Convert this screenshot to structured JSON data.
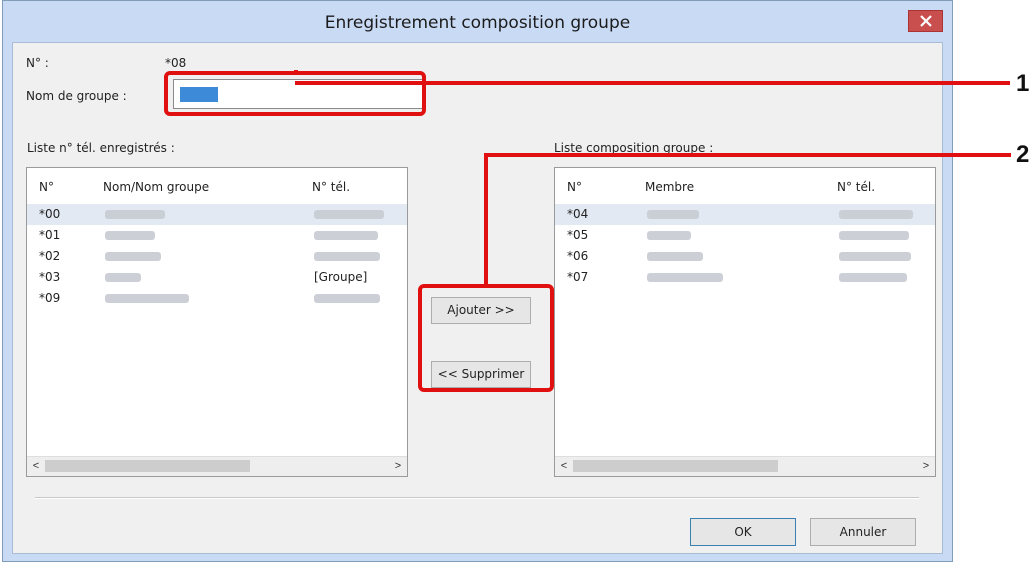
{
  "window": {
    "title": "Enregistrement composition groupe",
    "close_icon": "close-icon"
  },
  "fields": {
    "number_label": "N° :",
    "number_value": "*08",
    "group_name_label": "Nom de groupe :",
    "group_name_value": ""
  },
  "left_list": {
    "title": "Liste n° tél. enregistrés :",
    "columns": [
      "N°",
      "Nom/Nom groupe",
      "N° tél."
    ],
    "rows": [
      {
        "no": "*00",
        "name": "",
        "tel": ""
      },
      {
        "no": "*01",
        "name": "",
        "tel": ""
      },
      {
        "no": "*02",
        "name": "",
        "tel": ""
      },
      {
        "no": "*03",
        "name": "",
        "tel": "[Groupe]"
      },
      {
        "no": "*09",
        "name": "",
        "tel": ""
      }
    ]
  },
  "right_list": {
    "title": "Liste composition groupe :",
    "columns": [
      "N°",
      "Membre",
      "N° tél."
    ],
    "rows": [
      {
        "no": "*04",
        "name": "",
        "tel": ""
      },
      {
        "no": "*05",
        "name": "",
        "tel": ""
      },
      {
        "no": "*06",
        "name": "",
        "tel": ""
      },
      {
        "no": "*07",
        "name": "",
        "tel": ""
      }
    ]
  },
  "buttons": {
    "add": "Ajouter >>",
    "remove": "<< Supprimer",
    "ok": "OK",
    "cancel": "Annuler"
  },
  "scrollbar": {
    "left_arrow": "<",
    "right_arrow": ">"
  },
  "callouts": {
    "one": "1",
    "two": "2"
  },
  "colors": {
    "highlight": "#e01010",
    "close_button": "#c94f4f",
    "selection": "#3c8ad8"
  }
}
